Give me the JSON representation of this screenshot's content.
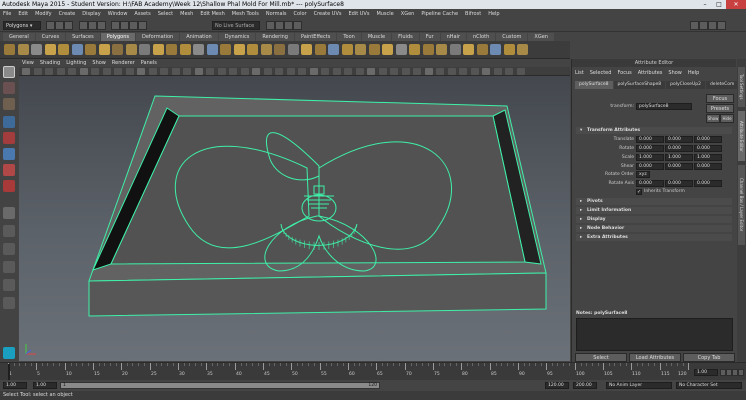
{
  "window": {
    "title": "Autodesk Maya 2015 - Student Version: H:\\FAB Academy\\Week 12\\Shallow Phal Mold For Mill.mb*   ---   polySurface8"
  },
  "menus": [
    "File",
    "Edit",
    "Modify",
    "Create",
    "Display",
    "Window",
    "Assets",
    "Select",
    "Mesh",
    "Edit Mesh",
    "Mesh Tools",
    "Normals",
    "Color",
    "Create UVs",
    "Edit UVs",
    "Muscle",
    "XGen",
    "Pipeline Cache",
    "Bifrost",
    "Help"
  ],
  "status": {
    "mode": "Polygons",
    "live": "No Live Surface"
  },
  "shelf_tabs": [
    "General",
    "Curves",
    "Surfaces",
    "Polygons",
    "Deformation",
    "Animation",
    "Dynamics",
    "Rendering",
    "PaintEffects",
    "Toon",
    "Muscle",
    "Fluids",
    "Fur",
    "nHair",
    "nCloth",
    "Custom",
    "XGen"
  ],
  "shelf_active": "Polygons",
  "viewport": {
    "menus": [
      "View",
      "Shading",
      "Lighting",
      "Show",
      "Renderer",
      "Panels"
    ],
    "colors": {
      "wire": "#3ef0a8",
      "surface": "#626262",
      "floor": "#525252"
    }
  },
  "attribute_editor": {
    "title": "Attribute Editor",
    "menus": [
      "List",
      "Selected",
      "Focus",
      "Attributes",
      "Show",
      "Help"
    ],
    "tabs": [
      "polySurface8",
      "polySurfaceShape8",
      "polyCloseUp2",
      "deleteCom"
    ],
    "transform_label": "transform:",
    "transform_value": "polySurface8",
    "buttons": {
      "focus": "Focus",
      "presets": "Presets",
      "show": "Show",
      "hide": "Hide"
    },
    "section_transform": "Transform Attributes",
    "attrs": [
      {
        "label": "Translate",
        "values": [
          "0.000",
          "0.000",
          "0.000"
        ]
      },
      {
        "label": "Rotate",
        "values": [
          "0.000",
          "0.000",
          "0.000"
        ]
      },
      {
        "label": "Scale",
        "values": [
          "1.000",
          "1.000",
          "1.000"
        ]
      },
      {
        "label": "Shear",
        "values": [
          "0.000",
          "0.000",
          "0.000"
        ]
      }
    ],
    "rotate_order_label": "Rotate Order",
    "rotate_order_value": "xyz",
    "rotate_axis_label": "Rotate Axis",
    "rotate_axis_values": [
      "0.000",
      "0.000",
      "0.000"
    ],
    "inherits_label": "Inherits Transform",
    "sections": [
      "Pivots",
      "Limit Information",
      "Display",
      "Node Behavior",
      "Extra Attributes"
    ],
    "notes_label": "Notes: polySurface8",
    "bottom_buttons": [
      "Select",
      "Load Attributes",
      "Copy Tab"
    ]
  },
  "side_tabs": [
    "Tool Settings",
    "Attribute Editor",
    "Channel Box / Layer Editor"
  ],
  "timeline": {
    "ticks": [
      "1",
      "5",
      "10",
      "15",
      "20",
      "25",
      "30",
      "35",
      "40",
      "45",
      "50",
      "55",
      "60",
      "65",
      "70",
      "75",
      "80",
      "85",
      "90",
      "95",
      "100",
      "105",
      "110",
      "115",
      "120"
    ],
    "current_frame": "1.00"
  },
  "range": {
    "start": "1.00",
    "inner_start": "1.00",
    "inner_display": "1",
    "end_display": "120",
    "inner_end": "120.00",
    "end": "200.00",
    "anim_layer": "No Anim Layer",
    "char_set": "No Character Set"
  },
  "help": "Select Tool: select an object"
}
